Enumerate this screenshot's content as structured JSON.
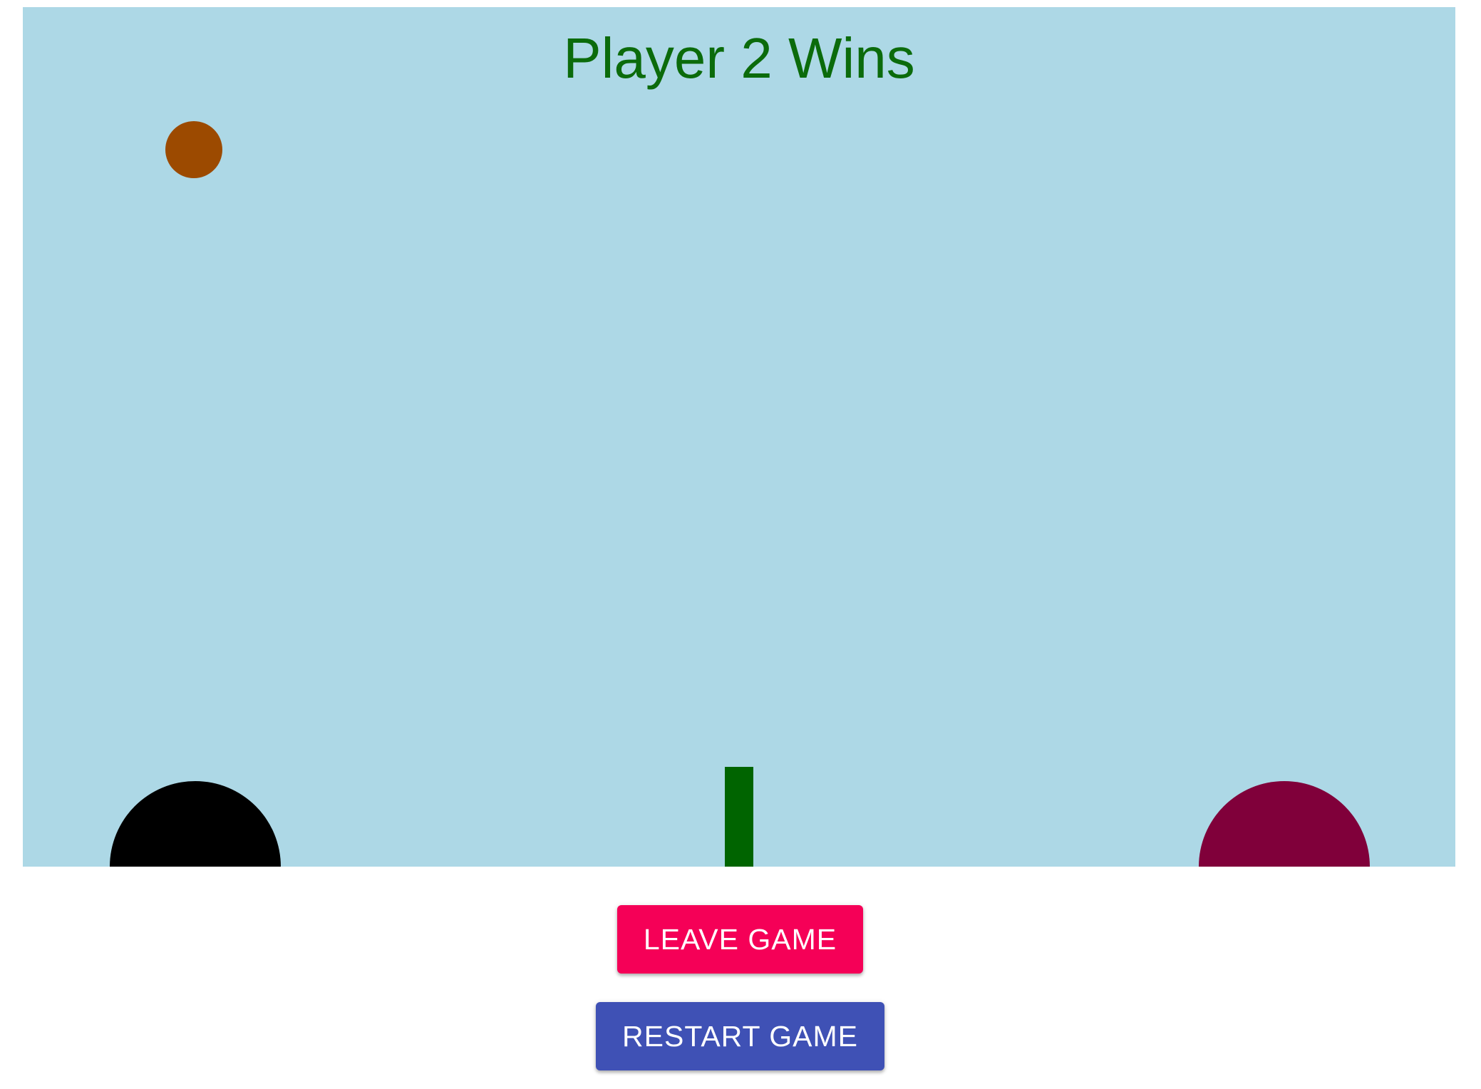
{
  "game": {
    "status_text": "Player 2 Wins",
    "colors": {
      "board": "#add8e6",
      "status_text": "#0b6b0b",
      "ball": "#9c4a00",
      "net": "#006400",
      "player_one": "#000000",
      "player_two": "#80003a"
    }
  },
  "buttons": {
    "leave_label": "LEAVE GAME",
    "leave_color": "#f50057",
    "restart_label": "RESTART GAME",
    "restart_color": "#3f51b5"
  }
}
